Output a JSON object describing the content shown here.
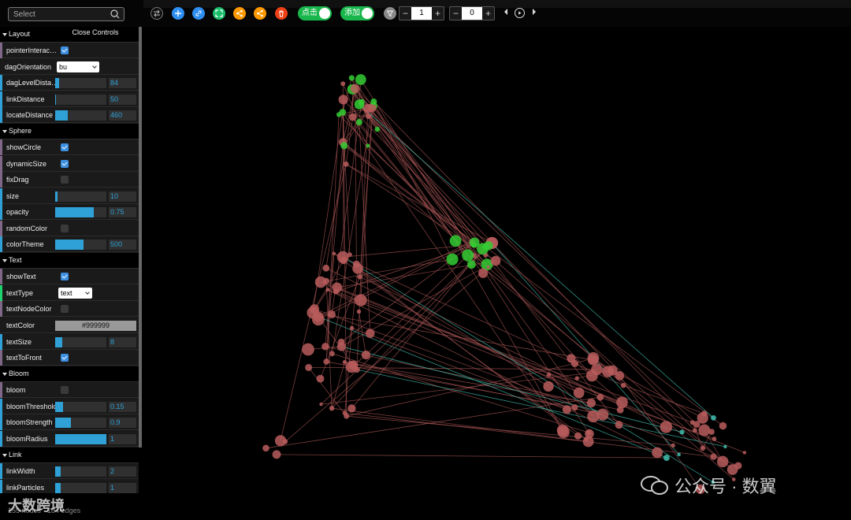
{
  "search": {
    "placeholder": "Select"
  },
  "toolbar": {
    "toggle_click_label": "点击",
    "toggle_add_label": "添加",
    "stepper1_value": "1",
    "stepper2_value": "0",
    "minus": "−",
    "plus": "+",
    "colors": {
      "blue": "#2f8ff0",
      "green": "#19be6b",
      "orange": "#ff9900",
      "red": "#ed4014",
      "grey": "#8a8a8a"
    }
  },
  "panel": {
    "close_label": "Close Controls",
    "folders": {
      "layout": "Layout",
      "sphere": "Sphere",
      "text": "Text",
      "bloom": "Bloom",
      "link": "Link"
    },
    "controls": {
      "pointerInteraction": {
        "label": "pointerInterac…",
        "checked": true
      },
      "dagOrientation": {
        "label": "dagOrientation",
        "value": "bu"
      },
      "dagLevelDistance": {
        "label": "dagLevelDista…",
        "value": "84",
        "fraction": 0.08
      },
      "linkDistance": {
        "label": "linkDistance",
        "value": "50",
        "fraction": 0.02
      },
      "locateDistance": {
        "label": "locateDistance",
        "value": "460",
        "fraction": 0.25
      },
      "showCircle": {
        "label": "showCircle",
        "checked": true
      },
      "dynamicSize": {
        "label": "dynamicSize",
        "checked": true
      },
      "fixDrag": {
        "label": "fixDrag",
        "checked": false
      },
      "size": {
        "label": "size",
        "value": "10",
        "fraction": 0.04
      },
      "opacity": {
        "label": "opacity",
        "value": "0.75",
        "fraction": 0.75
      },
      "randomColor": {
        "label": "randomColor",
        "checked": false
      },
      "colorTheme": {
        "label": "colorTheme",
        "value": "500",
        "fraction": 0.55
      },
      "showText": {
        "label": "showText",
        "checked": true
      },
      "textType": {
        "label": "textType",
        "value": "text"
      },
      "textNodeColor": {
        "label": "textNodeColor",
        "checked": false
      },
      "textColor": {
        "label": "textColor",
        "value": "#999999"
      },
      "textSize": {
        "label": "textSize",
        "value": "8",
        "fraction": 0.14
      },
      "textToFront": {
        "label": "textToFront",
        "checked": true
      },
      "bloom": {
        "label": "bloom",
        "checked": false
      },
      "bloomThreshold": {
        "label": "bloomThreshold",
        "value": "0.15",
        "fraction": 0.15
      },
      "bloomStrength": {
        "label": "bloomStrength",
        "value": "0.9",
        "fraction": 0.3
      },
      "bloomRadius": {
        "label": "bloomRadius",
        "value": "1",
        "fraction": 1.0
      },
      "linkWidth": {
        "label": "linkWidth",
        "value": "2",
        "fraction": 0.1
      },
      "linkParticles": {
        "label": "linkParticles",
        "value": "1",
        "fraction": 0.1
      }
    }
  },
  "footer": {
    "status": "155 nodes · 184 edges"
  },
  "watermarks": {
    "left": "大数跨境",
    "right": "公众号 · 数翼"
  },
  "graph": {
    "node_color": "#b85c5c",
    "active_color": "#33cc33",
    "selected_color": "#40c0b0",
    "edge_color": "#a05050"
  }
}
